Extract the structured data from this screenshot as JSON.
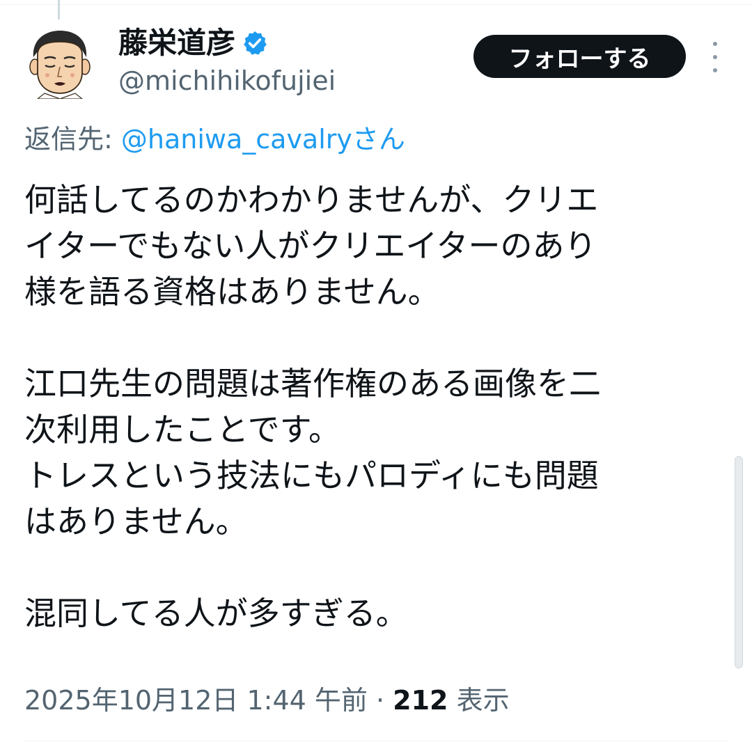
{
  "author": {
    "display_name": "藤栄道彦",
    "handle": "@michihikofujiei",
    "verified_icon": "verified-badge-icon"
  },
  "actions": {
    "follow_label": "フォローする",
    "more_icon": "more-vertical-icon"
  },
  "reply": {
    "prefix": "返信先: ",
    "mention": "@haniwa_cavalryさん"
  },
  "tweet": {
    "lines": [
      "何話してるのかわかりませんが、クリエ",
      "イターでもない人がクリエイターのあり",
      "様を語る資格はありません。",
      "",
      "江口先生の問題は著作権のある画像を二",
      "次利用したことです。",
      "トレスという技法にもパロディにも問題",
      "はありません。",
      "",
      "混同してる人が多すぎる。"
    ]
  },
  "meta": {
    "timestamp": "2025年10月12日 1:44 午前",
    "separator": " · ",
    "views_count": "212",
    "views_label": " 表示"
  },
  "colors": {
    "text": "#0f1419",
    "secondary": "#536471",
    "link": "#1d9bf0",
    "verified": "#1d9bf0",
    "follow_bg": "#0f1419"
  }
}
